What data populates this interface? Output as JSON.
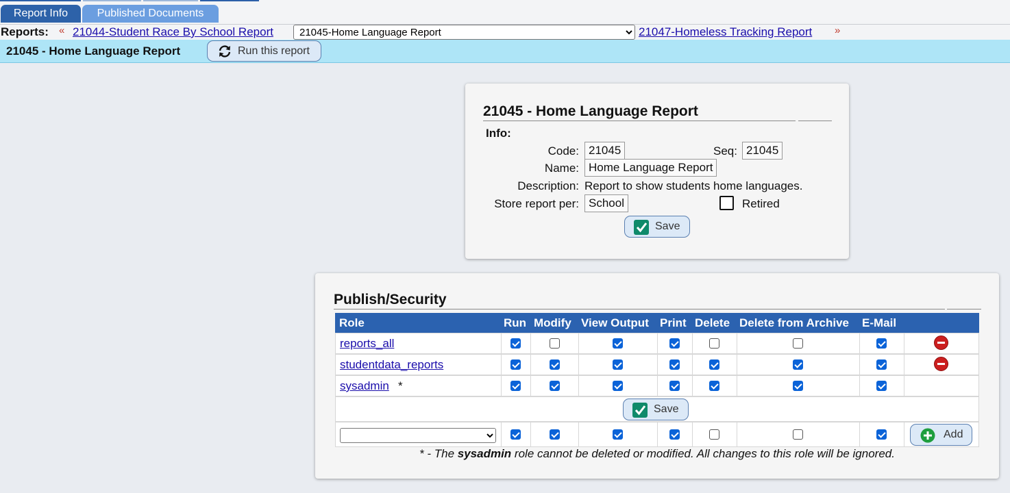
{
  "tabs": {
    "report_info": "Report Info",
    "published_documents": "Published Documents"
  },
  "nav": {
    "reports_label": "Reports:",
    "prev_arrow": "«",
    "next_arrow": "»",
    "prev_report": "21044-Student Race By School Report",
    "current_report": "21045-Home Language Report",
    "next_report": "21047-Homeless Tracking Report"
  },
  "titlebar": {
    "title": "21045 - Home Language Report",
    "run_button": "Run this report"
  },
  "info_panel": {
    "title": "21045 - Home Language Report",
    "info_label": "Info:",
    "code_label": "Code:",
    "code_value": "21045",
    "seq_label": "Seq:",
    "seq_value": "21045",
    "name_label": "Name:",
    "name_value": "Home Language Report",
    "description_label": "Description:",
    "description_value": "Report to show students home languages.",
    "store_label": "Store report per:",
    "store_value": "School",
    "retired_label": "Retired",
    "save_label": "Save"
  },
  "security_panel": {
    "title": "Publish/Security",
    "columns": [
      "Role",
      "Run",
      "Modify",
      "View Output",
      "Print",
      "Delete",
      "Delete from Archive",
      "E-Mail"
    ],
    "rows": [
      {
        "role": "reports_all",
        "suffix": "",
        "perms": [
          true,
          false,
          true,
          true,
          false,
          false,
          true
        ],
        "deletable": true
      },
      {
        "role": "studentdata_reports",
        "suffix": "",
        "perms": [
          true,
          true,
          true,
          true,
          true,
          true,
          true
        ],
        "deletable": true
      },
      {
        "role": "sysadmin",
        "suffix": "*",
        "perms": [
          true,
          true,
          true,
          true,
          true,
          true,
          true
        ],
        "deletable": false
      }
    ],
    "save_label": "Save",
    "new_row": {
      "role_value": "",
      "perms": [
        true,
        true,
        true,
        true,
        false,
        false,
        true
      ],
      "add_label": "Add"
    },
    "footnote": {
      "prefix": "* - The ",
      "role": "sysadmin",
      "suffix": " role cannot be deleted or modified. All changes to this role will be ignored."
    }
  },
  "colors": {
    "tab_active": "#2d62a9",
    "tab_inactive": "#6b9ee0",
    "titlebar_bg": "#aee5f7",
    "table_header": "#2b62b0",
    "checkbox_on": "#0b63d8",
    "delete_icon": "#cc1f1f",
    "add_icon": "#1e9e3e",
    "save_icon": "#0f8a6a"
  }
}
